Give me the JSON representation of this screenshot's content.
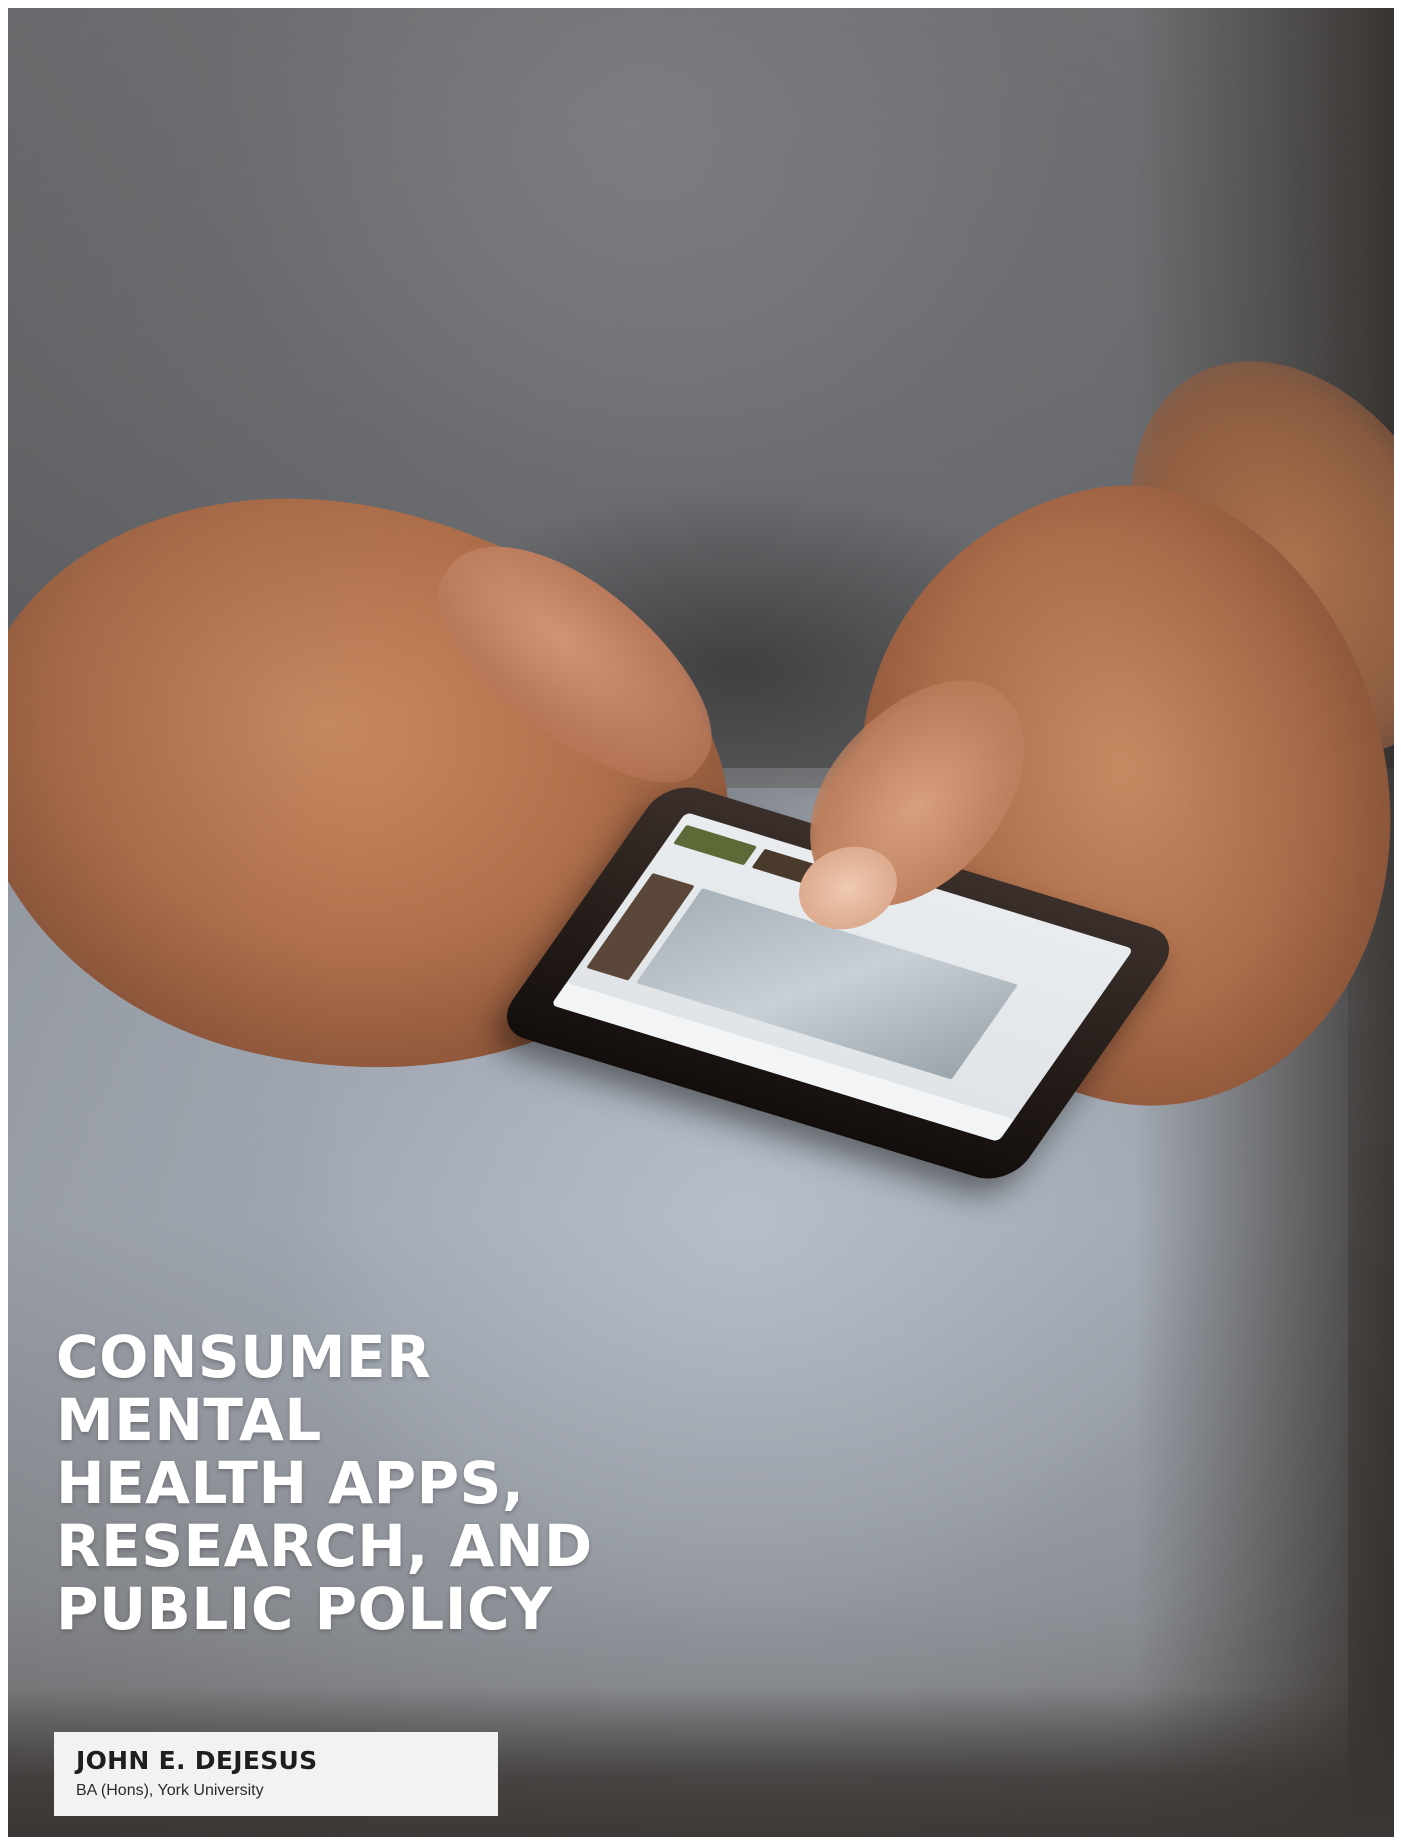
{
  "cover": {
    "title_lines": [
      "CONSUMER",
      "MENTAL",
      "HEALTH APPS,",
      "RESEARCH, AND",
      "PUBLIC POLICY"
    ],
    "author": {
      "name": "JOHN E. DEJESUS",
      "affiliation": "BA (Hons), York University"
    },
    "photo_subject": "hands holding a smartphone",
    "colors": {
      "title_text": "#ffffff",
      "author_box_bg": "#f2f2f1",
      "author_text": "#1e1e1e"
    }
  }
}
